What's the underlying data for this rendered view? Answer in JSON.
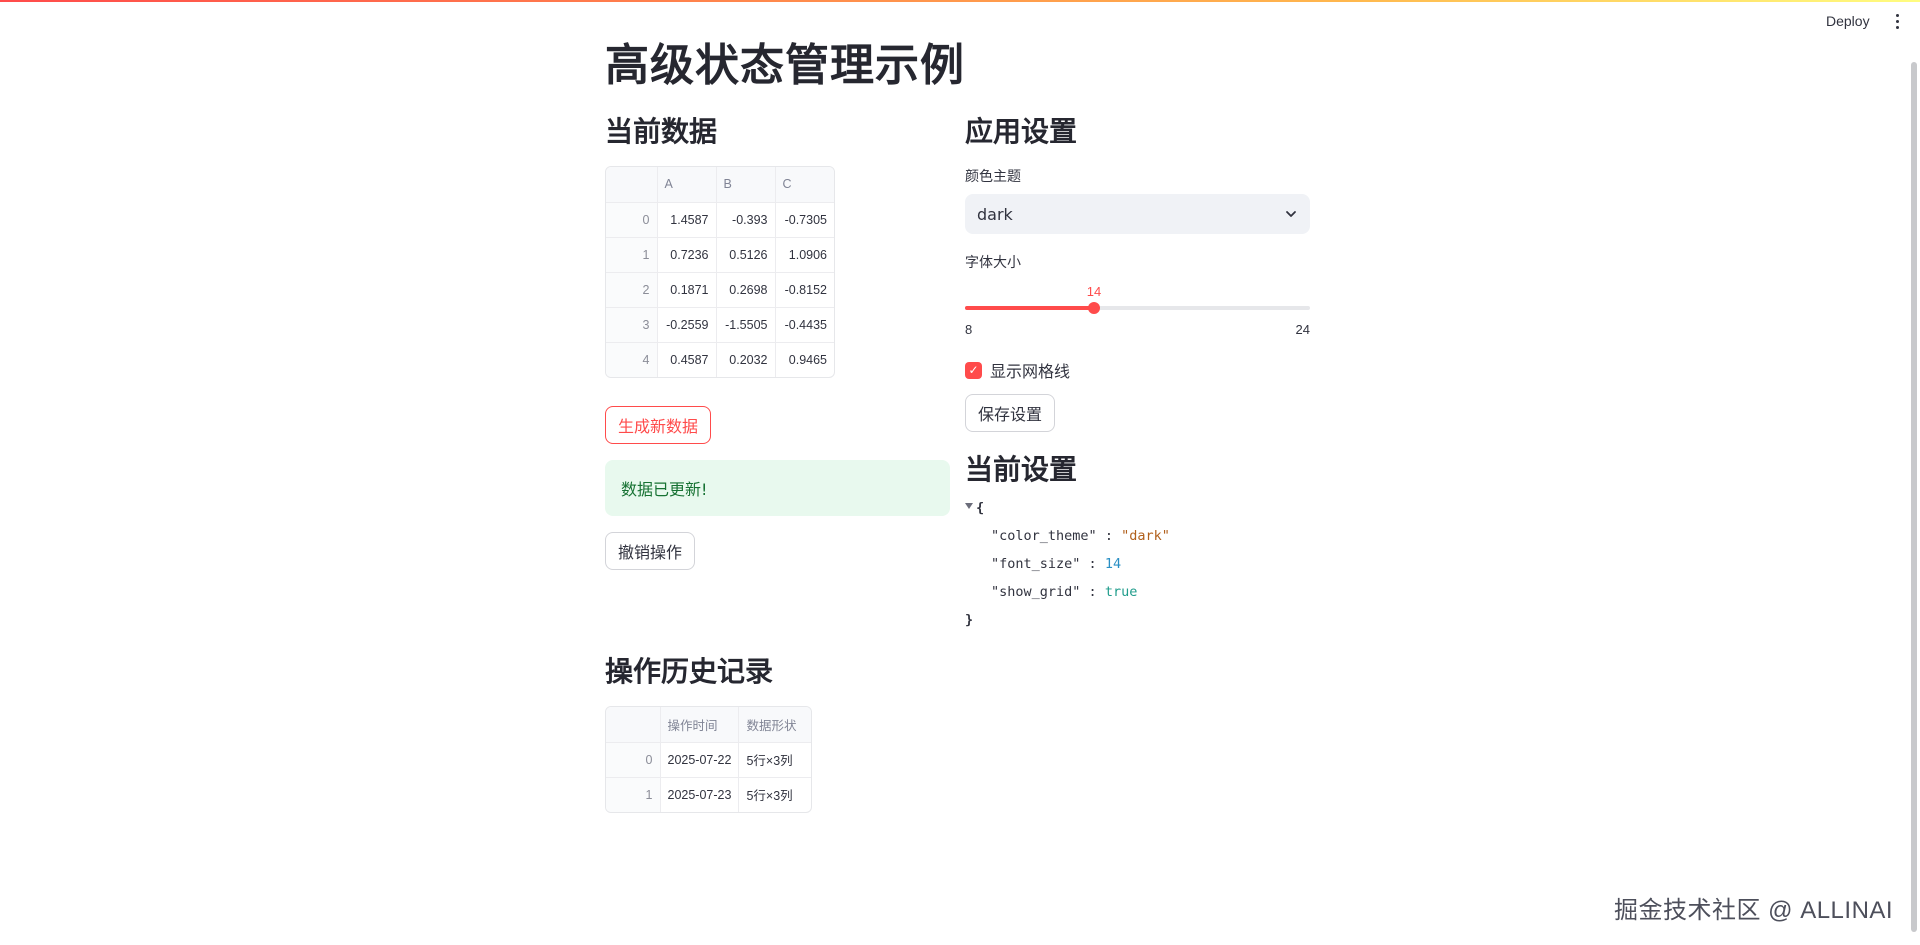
{
  "app": {
    "title": "高级状态管理示例",
    "deploy_label": "Deploy",
    "menu_icon": "kebab-menu-icon"
  },
  "current_data": {
    "heading": "当前数据",
    "columns": [
      "",
      "A",
      "B",
      "C"
    ],
    "rows": [
      [
        "0",
        "1.4587",
        "-0.393",
        "-0.7305"
      ],
      [
        "1",
        "0.7236",
        "0.5126",
        "1.0906"
      ],
      [
        "2",
        "0.1871",
        "0.2698",
        "-0.8152"
      ],
      [
        "3",
        "-0.2559",
        "-1.5505",
        "-0.4435"
      ],
      [
        "4",
        "0.4587",
        "0.2032",
        "0.9465"
      ]
    ],
    "generate_button": "生成新数据",
    "success_message": "数据已更新!",
    "undo_button": "撤销操作"
  },
  "settings": {
    "heading": "应用设置",
    "theme_label": "颜色主题",
    "theme_value": "dark",
    "font_size_label": "字体大小",
    "font_size_value": "14",
    "font_size_min": "8",
    "font_size_max": "24",
    "font_size_fraction": 0.375,
    "show_grid_label": "显示网格线",
    "show_grid_checked": true,
    "save_button": "保存设置"
  },
  "current_settings": {
    "heading": "当前设置",
    "open_brace": "{",
    "close_brace": "}",
    "entries": [
      {
        "key": "\"color_theme\"",
        "sep": ":",
        "value": "\"dark\"",
        "kind": "str"
      },
      {
        "key": "\"font_size\"",
        "sep": ":",
        "value": "14",
        "kind": "num"
      },
      {
        "key": "\"show_grid\"",
        "sep": ":",
        "value": "true",
        "kind": "bool"
      }
    ]
  },
  "history": {
    "heading": "操作历史记录",
    "columns": [
      "",
      "操作时间",
      "数据形状"
    ],
    "rows": [
      [
        "0",
        "2025-07-22",
        "5行×3列"
      ],
      [
        "1",
        "2025-07-23",
        "5行×3列"
      ]
    ]
  },
  "watermark": "掘金技术社区 @ ALLINAI",
  "colors": {
    "primary": "#ff4b4b",
    "success_bg": "#e8f9ee",
    "success_text": "#177233"
  }
}
